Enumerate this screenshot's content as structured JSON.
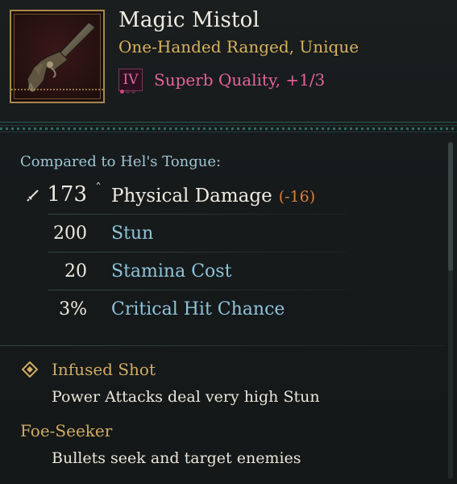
{
  "item": {
    "name": "Magic Mistol",
    "subtitle": "One-Handed Ranged, Unique",
    "tier": "IV",
    "quality": "Superb Quality, +1/3"
  },
  "comparison": {
    "label": "Compared to Hel's Tongue:",
    "stats": [
      {
        "value": "173",
        "label": "Physical Damage",
        "diff": "(-16)"
      },
      {
        "value": "200",
        "label": "Stun"
      },
      {
        "value": "20",
        "label": "Stamina Cost"
      },
      {
        "value": "3%",
        "label": "Critical Hit Chance"
      }
    ]
  },
  "perks": [
    {
      "name": "Infused Shot",
      "description": "Power Attacks deal very high Stun"
    },
    {
      "name": "Foe-Seeker",
      "description": "Bullets seek and target enemies"
    }
  ],
  "colors": {
    "gold": "#d2ab63",
    "quality_pink": "#e5639b",
    "stat_blue": "#8fc3da",
    "negative": "#de7d3a"
  }
}
